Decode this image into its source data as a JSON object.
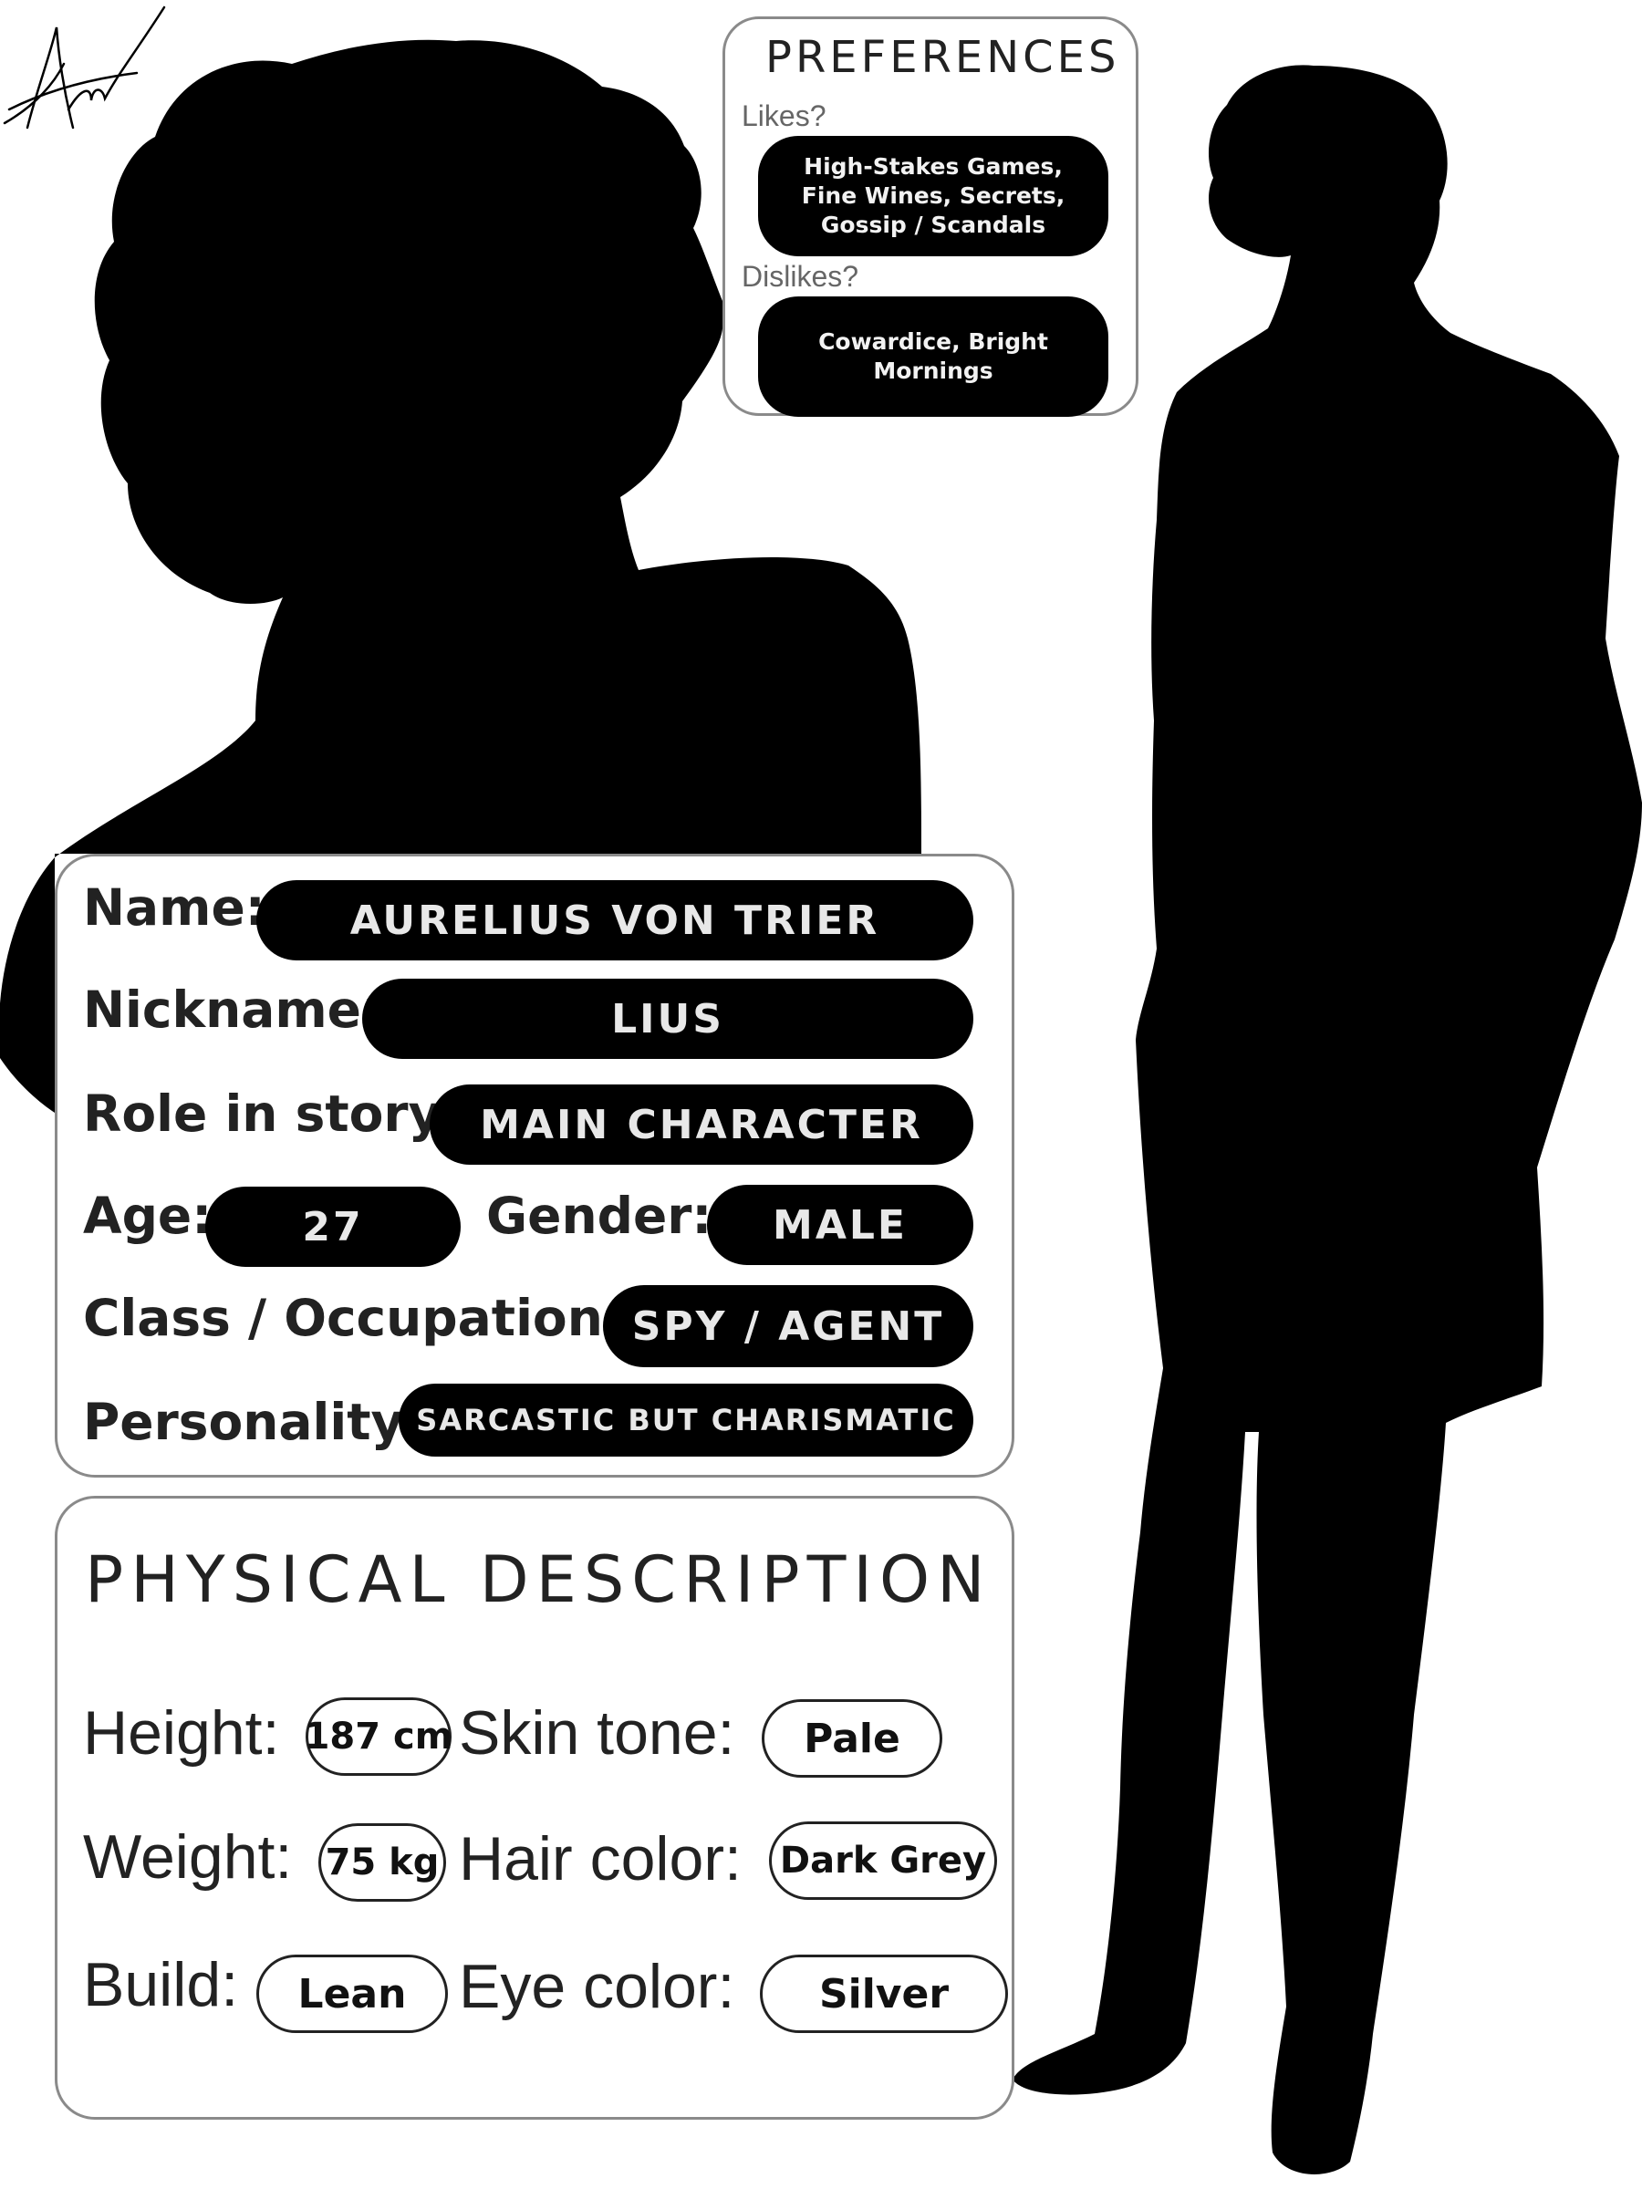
{
  "preferences": {
    "title": "PREFERENCES",
    "likes_label": "Likes?",
    "likes_value": "High-Stakes Games, Fine Wines, Secrets, Gossip / Scandals",
    "dislikes_label": "Dislikes?",
    "dislikes_value": "Cowardice, Bright Mornings"
  },
  "profile": {
    "name_label": "Name:",
    "name_value": "AURELIUS VON TRIER",
    "nickname_label": "Nickname:",
    "nickname_value": "LIUS",
    "role_label": "Role in story:",
    "role_value": "MAIN CHARACTER",
    "age_label": "Age:",
    "age_value": "27",
    "gender_label": "Gender:",
    "gender_value": "MALE",
    "occupation_label": "Class / Occupation:",
    "occupation_value": "SPY / AGENT",
    "personality_label": "Personality:",
    "personality_value": "SARCASTIC BUT CHARISMATIC"
  },
  "physical": {
    "title": "PHYSICAL DESCRIPTION",
    "height_label": "Height:",
    "height_value": "187 cm",
    "skin_label": "Skin tone:",
    "skin_value": "Pale",
    "weight_label": "Weight:",
    "weight_value": "75 kg",
    "hair_label": "Hair color:",
    "hair_value": "Dark Grey",
    "build_label": "Build:",
    "build_value": "Lean",
    "eye_label": "Eye color:",
    "eye_value": "Silver"
  },
  "colors": {
    "silhouette": "#000000",
    "card_border": "#8a8a8a",
    "pill_text": "#e8e8e8"
  },
  "icons": {
    "signature": "signature-mark"
  }
}
